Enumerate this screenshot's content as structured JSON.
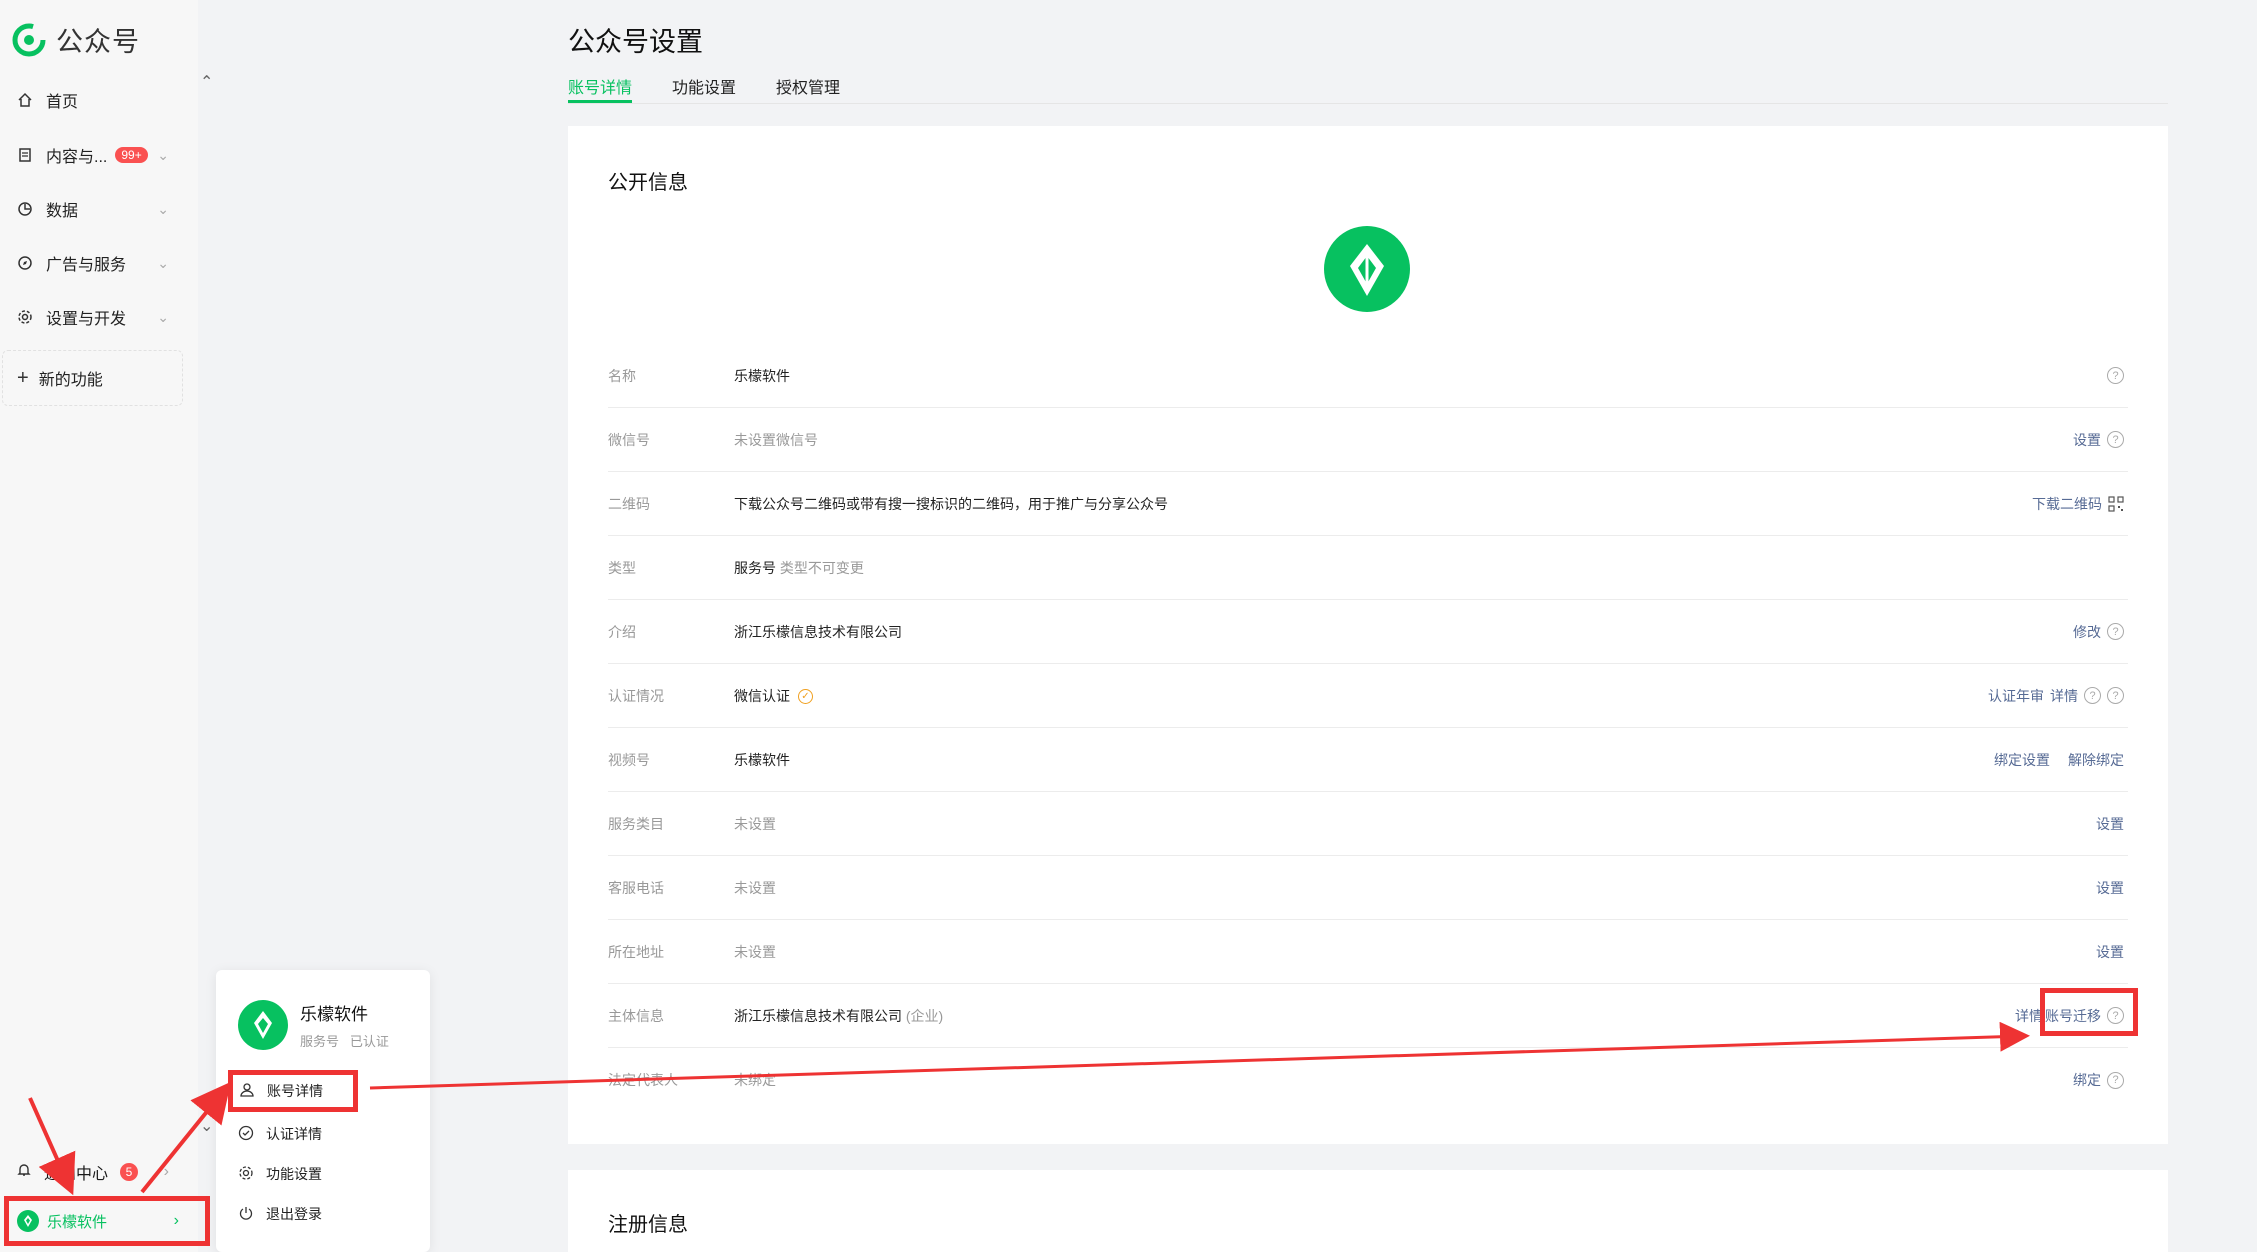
{
  "app": {
    "logo_text": "公众号"
  },
  "sidebar": {
    "items": [
      {
        "label": "首页",
        "icon": "home-icon"
      },
      {
        "label": "内容与...",
        "icon": "document-icon",
        "badge": "99+"
      },
      {
        "label": "数据",
        "icon": "chart-icon"
      },
      {
        "label": "广告与服务",
        "icon": "compass-icon"
      },
      {
        "label": "设置与开发",
        "icon": "gear-icon"
      }
    ],
    "new_feature": "新的功能",
    "notice_label": "通知中心",
    "notice_badge": "5",
    "account_name": "乐檬软件"
  },
  "popover": {
    "name": "乐檬软件",
    "type": "服务号",
    "status": "已认证",
    "items": [
      {
        "label": "账号详情",
        "icon": "user-icon"
      },
      {
        "label": "认证详情",
        "icon": "check-circle-icon"
      },
      {
        "label": "功能设置",
        "icon": "gear-icon"
      },
      {
        "label": "退出登录",
        "icon": "power-icon"
      }
    ]
  },
  "page": {
    "title": "公众号设置",
    "tabs": [
      "账号详情",
      "功能设置",
      "授权管理"
    ],
    "section_public": "公开信息",
    "section_register": "注册信息"
  },
  "rows": [
    {
      "label": "名称",
      "value": "乐檬软件"
    },
    {
      "label": "微信号",
      "value": "未设置微信号",
      "action": "设置"
    },
    {
      "label": "二维码",
      "value": "下载公众号二维码或带有搜一搜标识的二维码，用于推广与分享公众号",
      "action": "下载二维码"
    },
    {
      "label": "类型",
      "value": "服务号",
      "value_note": "类型不可变更"
    },
    {
      "label": "介绍",
      "value": "浙江乐檬信息技术有限公司",
      "action": "修改"
    },
    {
      "label": "认证情况",
      "value": "微信认证",
      "action": "认证年审",
      "action2": "详情"
    },
    {
      "label": "视频号",
      "value": "乐檬软件",
      "action": "绑定设置",
      "action2": "解除绑定"
    },
    {
      "label": "服务类目",
      "value": "未设置",
      "action": "设置"
    },
    {
      "label": "客服电话",
      "value": "未设置",
      "action": "设置"
    },
    {
      "label": "所在地址",
      "value": "未设置",
      "action": "设置"
    },
    {
      "label": "主体信息",
      "value": "浙江乐檬信息技术有限公司",
      "value_note": "(企业)",
      "action": "详情",
      "action2": "账号迁移"
    },
    {
      "label": "法定代表人",
      "value": "未绑定",
      "action": "绑定"
    }
  ],
  "colors": {
    "brand": "#07c160",
    "link": "#576b95",
    "annotation": "#e33333"
  }
}
